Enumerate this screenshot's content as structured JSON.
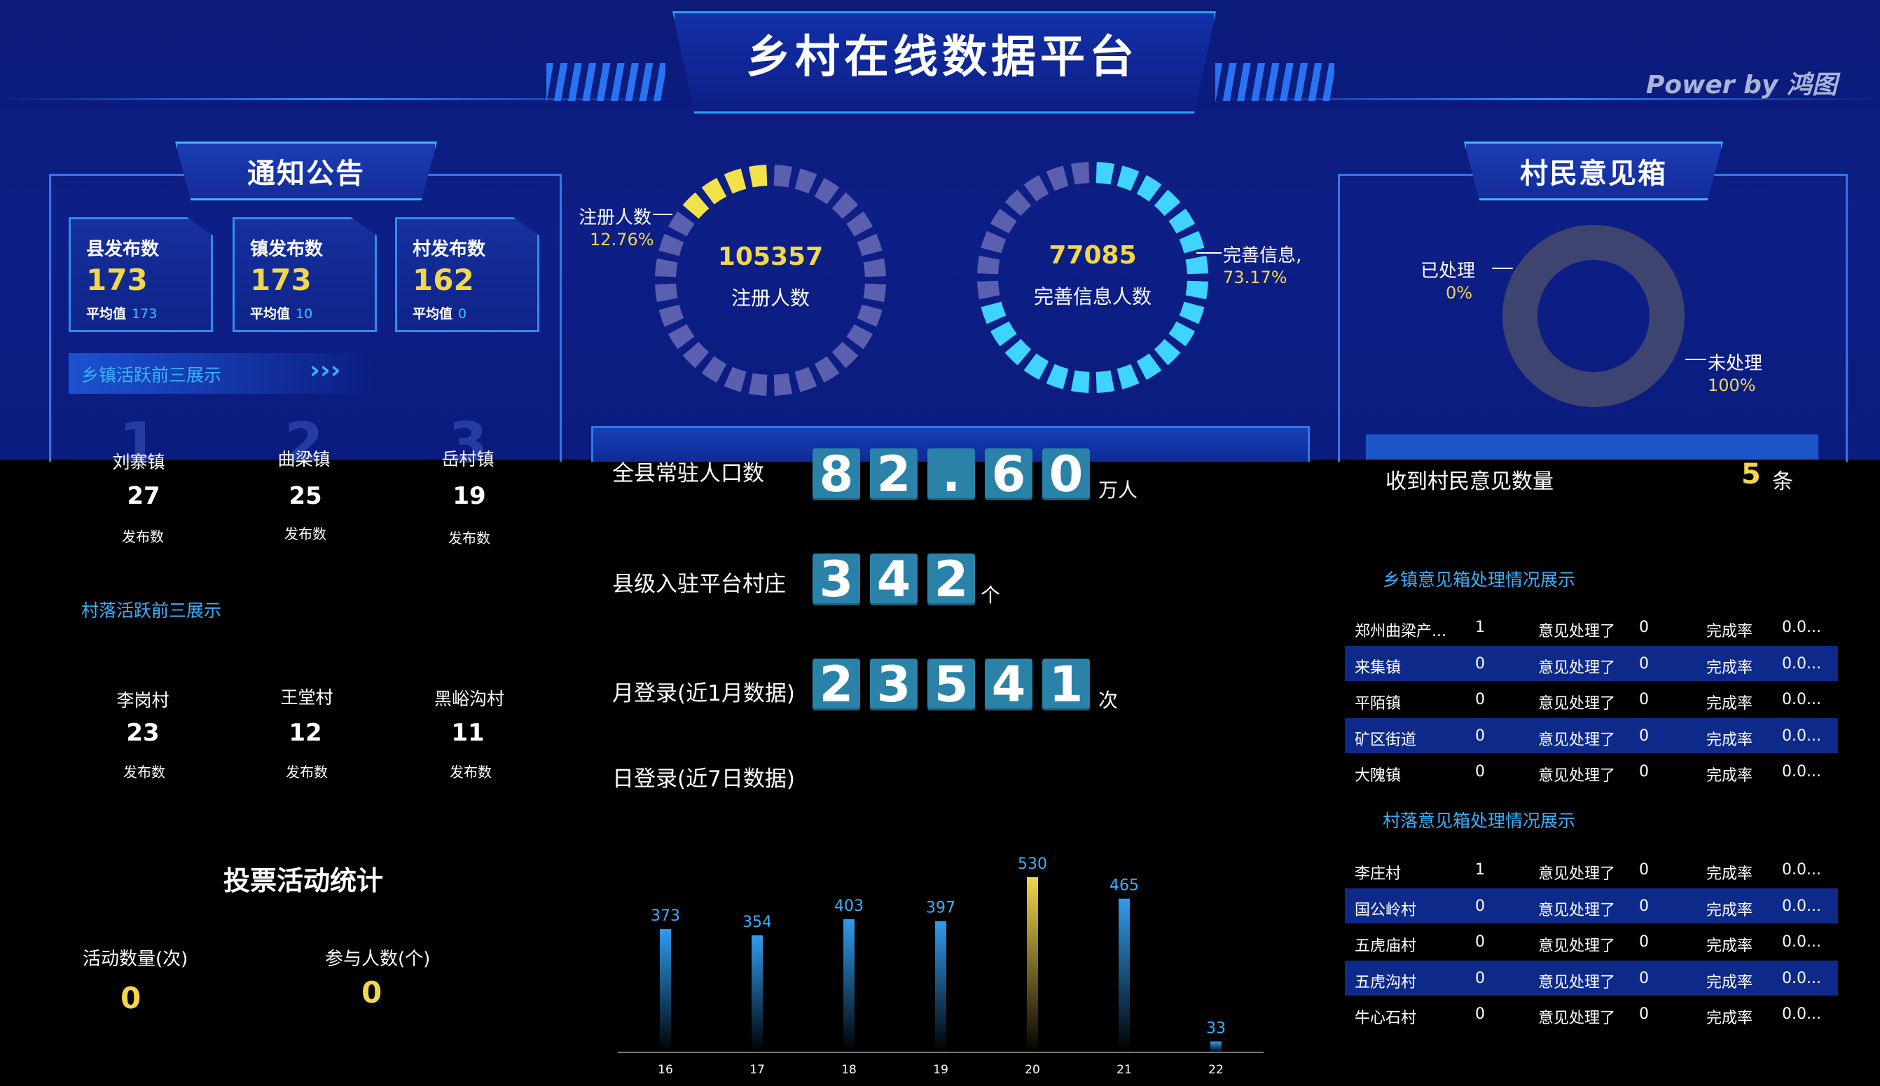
{
  "header": {
    "title": "乡村在线数据平台",
    "power": "Power by 鸿图"
  },
  "notice": {
    "title": "通知公告",
    "cards": [
      {
        "label": "县发布数",
        "value": "173",
        "avg_label": "平均值",
        "avg": "173"
      },
      {
        "label": "镇发布数",
        "value": "173",
        "avg_label": "平均值",
        "avg": "10"
      },
      {
        "label": "村发布数",
        "value": "162",
        "avg_label": "平均值",
        "avg": "0"
      }
    ],
    "town_title": "乡镇活跃前三展示",
    "town_arrows": "›››",
    "towns": [
      {
        "name": "刘寨镇",
        "value": "27",
        "sub": "发布数"
      },
      {
        "name": "曲梁镇",
        "value": "25",
        "sub": "发布数"
      },
      {
        "name": "岳村镇",
        "value": "19",
        "sub": "发布数"
      }
    ],
    "village_title": "村落活跃前三展示",
    "villages": [
      {
        "name": "李岗村",
        "value": "23",
        "sub": "发布数"
      },
      {
        "name": "王堂村",
        "value": "12",
        "sub": "发布数"
      },
      {
        "name": "黑峪沟村",
        "value": "11",
        "sub": "发布数"
      }
    ]
  },
  "vote": {
    "title": "投票活动统计",
    "count_label": "活动数量(次)",
    "count": "0",
    "people_label": "参与人数(个)",
    "people": "0"
  },
  "rings": [
    {
      "value": "105357",
      "label": "注册人数",
      "side_label": "注册人数",
      "side_pct": "12.76%",
      "fraction": 0.1276,
      "color": "#f2e24a",
      "base": "#5a5fb0"
    },
    {
      "value": "77085",
      "label": "完善信息人数",
      "side_label": "完善信息,",
      "side_pct": "73.17%",
      "fraction": 0.7317,
      "color": "#3fd4ff",
      "base": "#5a5fb0"
    }
  ],
  "stats": [
    {
      "label": "全县常驻人口数",
      "digits": [
        "8",
        "2",
        ".",
        "6",
        "0"
      ],
      "unit": "万人"
    },
    {
      "label": "县级入驻平台村庄",
      "digits": [
        "3",
        "4",
        "2"
      ],
      "unit": "个"
    },
    {
      "label": "月登录(近1月数据)",
      "digits": [
        "2",
        "3",
        "5",
        "4",
        "1"
      ],
      "unit": "次"
    }
  ],
  "chart_data": {
    "type": "bar",
    "title": "日登录(近7日数据)",
    "categories": [
      "16",
      "17",
      "18",
      "19",
      "20",
      "21",
      "22"
    ],
    "values": [
      373,
      354,
      403,
      397,
      530,
      465,
      33
    ],
    "highlight_index": 4,
    "ylim": [
      0,
      530
    ]
  },
  "opinion": {
    "title": "村民意见箱",
    "processed_label": "已处理",
    "processed_pct": "0%",
    "unprocessed_label": "未处理",
    "unprocessed_pct": "100%",
    "received_label": "收到村民意见数量",
    "received": "5",
    "received_unit": "条",
    "town_title": "乡镇意见箱处理情况展示",
    "town_rows": [
      {
        "name": "郑州曲梁产...",
        "count": "1",
        "proc_label": "意见处理了",
        "proc": "0",
        "rate_label": "完成率",
        "rate": "0.0..."
      },
      {
        "name": "来集镇",
        "count": "0",
        "proc_label": "意见处理了",
        "proc": "0",
        "rate_label": "完成率",
        "rate": "0.0..."
      },
      {
        "name": "平陌镇",
        "count": "0",
        "proc_label": "意见处理了",
        "proc": "0",
        "rate_label": "完成率",
        "rate": "0.0..."
      },
      {
        "name": "矿区街道",
        "count": "0",
        "proc_label": "意见处理了",
        "proc": "0",
        "rate_label": "完成率",
        "rate": "0.0..."
      },
      {
        "name": "大隗镇",
        "count": "0",
        "proc_label": "意见处理了",
        "proc": "0",
        "rate_label": "完成率",
        "rate": "0.0..."
      }
    ],
    "village_title": "村落意见箱处理情况展示",
    "village_rows": [
      {
        "name": "李庄村",
        "count": "1",
        "proc_label": "意见处理了",
        "proc": "0",
        "rate_label": "完成率",
        "rate": "0.0..."
      },
      {
        "name": "国公岭村",
        "count": "0",
        "proc_label": "意见处理了",
        "proc": "0",
        "rate_label": "完成率",
        "rate": "0.0..."
      },
      {
        "name": "五虎庙村",
        "count": "0",
        "proc_label": "意见处理了",
        "proc": "0",
        "rate_label": "完成率",
        "rate": "0.0..."
      },
      {
        "name": "五虎沟村",
        "count": "0",
        "proc_label": "意见处理了",
        "proc": "0",
        "rate_label": "完成率",
        "rate": "0.0..."
      },
      {
        "name": "牛心石村",
        "count": "0",
        "proc_label": "意见处理了",
        "proc": "0",
        "rate_label": "完成率",
        "rate": "0.0..."
      }
    ]
  },
  "colors": {
    "accent": "#3ab0ff",
    "yellow": "#f2d74a",
    "band": "#0d1f86",
    "highlight_row": "#0d2a8a"
  }
}
